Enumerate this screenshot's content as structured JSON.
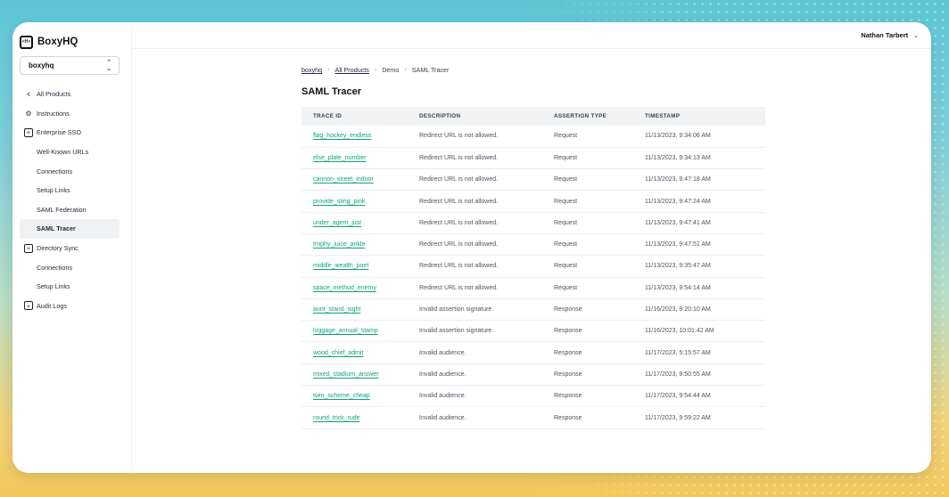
{
  "brand": {
    "name": "BoxyHQ",
    "logo_text": "<H>"
  },
  "team_select": {
    "value": "boxyhq"
  },
  "user": {
    "name": "Nathan Tarbert"
  },
  "sidebar": {
    "items": [
      {
        "label": "All Products",
        "icon": "chevron-left-icon",
        "sub": false
      },
      {
        "label": "Instructions",
        "icon": "gear-icon",
        "sub": false
      },
      {
        "label": "Enterprise SSO",
        "icon": "box-logo-icon",
        "sub": false
      },
      {
        "label": "Well-Known URLs",
        "sub": true
      },
      {
        "label": "Connections",
        "sub": true
      },
      {
        "label": "Setup Links",
        "sub": true
      },
      {
        "label": "SAML Federation",
        "sub": true
      },
      {
        "label": "SAML Tracer",
        "sub": true,
        "active": true
      },
      {
        "label": "Directory Sync",
        "icon": "box-logo-icon",
        "sub": false
      },
      {
        "label": "Connections",
        "sub": true
      },
      {
        "label": "Setup Links",
        "sub": true
      },
      {
        "label": "Audit Logs",
        "icon": "box-logo-icon",
        "sub": false
      }
    ]
  },
  "breadcrumb": {
    "items": [
      "boxyhq",
      "All Products",
      "Demo",
      "SAML Tracer"
    ]
  },
  "page": {
    "title": "SAML Tracer"
  },
  "table": {
    "headers": [
      "TRACE ID",
      "DESCRIPTION",
      "ASSERTION TYPE",
      "TIMESTAMP"
    ],
    "rows": [
      {
        "id": "flag_hockey_endless",
        "description": "Redirect URL is not allowed.",
        "type": "Request",
        "timestamp": "11/13/2023, 9:34:06 AM"
      },
      {
        "id": "else_plate_number",
        "description": "Redirect URL is not allowed.",
        "type": "Request",
        "timestamp": "11/13/2023, 9:34:13 AM"
      },
      {
        "id": "cannon_street_indoor",
        "description": "Redirect URL is not allowed.",
        "type": "Request",
        "timestamp": "11/13/2023, 9:47:18 AM"
      },
      {
        "id": "provide_sting_pink",
        "description": "Redirect URL is not allowed.",
        "type": "Request",
        "timestamp": "11/13/2023, 9:47:24 AM"
      },
      {
        "id": "under_agent_just",
        "description": "Redirect URL is not allowed.",
        "type": "Request",
        "timestamp": "11/13/2023, 9:47:41 AM"
      },
      {
        "id": "trophy_juice_ankle",
        "description": "Redirect URL is not allowed.",
        "type": "Request",
        "timestamp": "11/13/2023, 9:47:51 AM"
      },
      {
        "id": "middle_wealth_poet",
        "description": "Redirect URL is not allowed.",
        "type": "Request",
        "timestamp": "11/13/2023, 9:35:47 AM"
      },
      {
        "id": "space_method_enemy",
        "description": "Redirect URL is not allowed.",
        "type": "Request",
        "timestamp": "11/13/2023, 9:54:14 AM"
      },
      {
        "id": "aunt_stand_sight",
        "description": "Invalid assertion signature.",
        "type": "Response",
        "timestamp": "11/16/2023, 9:20:10 AM"
      },
      {
        "id": "luggage_annual_stamp",
        "description": "Invalid assertion signature.",
        "type": "Response",
        "timestamp": "11/16/2023, 10:01:42 AM"
      },
      {
        "id": "wood_chief_admit",
        "description": "Invalid audience.",
        "type": "Response",
        "timestamp": "11/17/2023, 5:15:57 AM"
      },
      {
        "id": "mixed_stadium_answer",
        "description": "Invalid audience.",
        "type": "Response",
        "timestamp": "11/17/2023, 9:50:55 AM"
      },
      {
        "id": "twin_scheme_cheap",
        "description": "Invalid audience.",
        "type": "Response",
        "timestamp": "11/17/2023, 9:54:44 AM"
      },
      {
        "id": "round_trick_rude",
        "description": "Invalid audience.",
        "type": "Response",
        "timestamp": "11/17/2023, 9:59:22 AM"
      }
    ]
  },
  "colors": {
    "link": "#10a37f",
    "active_bg": "#f0f1f3"
  }
}
